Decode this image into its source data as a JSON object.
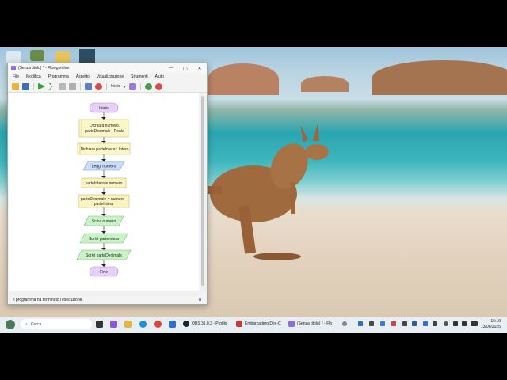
{
  "window": {
    "title": "(Senza titolo) * - Flowgorithm",
    "minimize": "—",
    "maximize": "▢",
    "close": "✕"
  },
  "menu": [
    "File",
    "Modifica",
    "Programma",
    "Aspetto",
    "Visualizzazione",
    "Strumenti",
    "Aiuto"
  ],
  "toolbar": {
    "start_label": "Inizio"
  },
  "flowchart": {
    "start": "Inizio",
    "declare1_line1": "Dichiara numero,",
    "declare1_line2": "parteDecimale : Reale",
    "declare2": "Dichiara parteIntera : Intero",
    "input": "Leggi numero",
    "assign1": "parteIntera = numero",
    "assign2_line1": "parteDecimale = numero -",
    "assign2_line2": "parteIntera",
    "output1": "Scrivi numero",
    "output2": "Scrivi parteIntera",
    "output3": "Scrivi parteDecimale",
    "end": "Fine"
  },
  "status": {
    "message": "Il programma ha terminato l'esecuzione.",
    "lang": "IT"
  },
  "taskbar": {
    "search_placeholder": "Cerca",
    "apps": [
      "OBS 31.0.3 - Profilo",
      "Embarcadero Dev-C",
      "(Senza titolo) * - Flo"
    ],
    "time": "16:19",
    "date": "13/06/2025"
  },
  "colors": {
    "terminal": "#e7d0f7",
    "terminal_border": "#b48bd6",
    "declare": "#fbf7c7",
    "declare_border": "#c8bd6a",
    "input": "#c9dcfa",
    "input_border": "#7fa2d8",
    "assign": "#fbf3c0",
    "output": "#c9f2c6",
    "output_border": "#79c27a"
  }
}
